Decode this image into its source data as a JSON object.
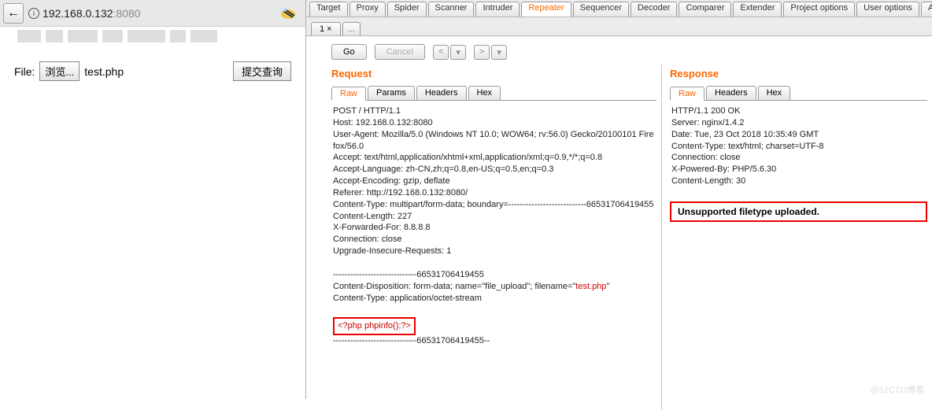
{
  "browser": {
    "url_host": "192.168.0.132",
    "url_port": ":8080",
    "back_glyph": "←"
  },
  "upload": {
    "label": "File:",
    "browse": "浏览...",
    "filename": "test.php",
    "submit": "提交查询"
  },
  "tabs": {
    "main": [
      "Target",
      "Proxy",
      "Spider",
      "Scanner",
      "Intruder",
      "Repeater",
      "Sequencer",
      "Decoder",
      "Comparer",
      "Extender",
      "Project options",
      "User options",
      "Alerts"
    ],
    "active_main": "Repeater",
    "sub_active": "1 ×",
    "sub_dots": "..."
  },
  "actions": {
    "go": "Go",
    "cancel": "Cancel",
    "prev": "<",
    "next": ">",
    "drop": "▾"
  },
  "request": {
    "title": "Request",
    "inner_tabs": [
      "Raw",
      "Params",
      "Headers",
      "Hex"
    ],
    "lines_top": "POST / HTTP/1.1\nHost: 192.168.0.132:8080\nUser-Agent: Mozilla/5.0 (Windows NT 10.0; WOW64; rv:56.0) Gecko/20100101 Firefox/56.0\nAccept: text/html,application/xhtml+xml,application/xml;q=0.9,*/*;q=0.8\nAccept-Language: zh-CN,zh;q=0.8,en-US;q=0.5,en;q=0.3\nAccept-Encoding: gzip, deflate\nReferer: http://192.168.0.132:8080/\nContent-Type: multipart/form-data; boundary=---------------------------66531706419455\nContent-Length: 227\nX-Forwarded-For: 8.8.8.8\nConnection: close\nUpgrade-Insecure-Requests: 1\n\n-----------------------------66531706419455",
    "cd_prefix": "Content-Disposition: form-data; name=\"file_upload\"; filename=\"",
    "cd_file": "test.php",
    "cd_suffix": "\"",
    "ct_line": "Content-Type: application/octet-stream",
    "payload": "<?php phpinfo();?>",
    "lines_end": "-----------------------------66531706419455--"
  },
  "response": {
    "title": "Response",
    "inner_tabs": [
      "Raw",
      "Headers",
      "Hex"
    ],
    "lines": "HTTP/1.1 200 OK\nServer: nginx/1.4.2\nDate: Tue, 23 Oct 2018 10:35:49 GMT\nContent-Type: text/html; charset=UTF-8\nConnection: close\nX-Powered-By: PHP/5.6.30\nContent-Length: 30",
    "body": "Unsupported filetype uploaded."
  },
  "watermark": "@51CTO博客"
}
